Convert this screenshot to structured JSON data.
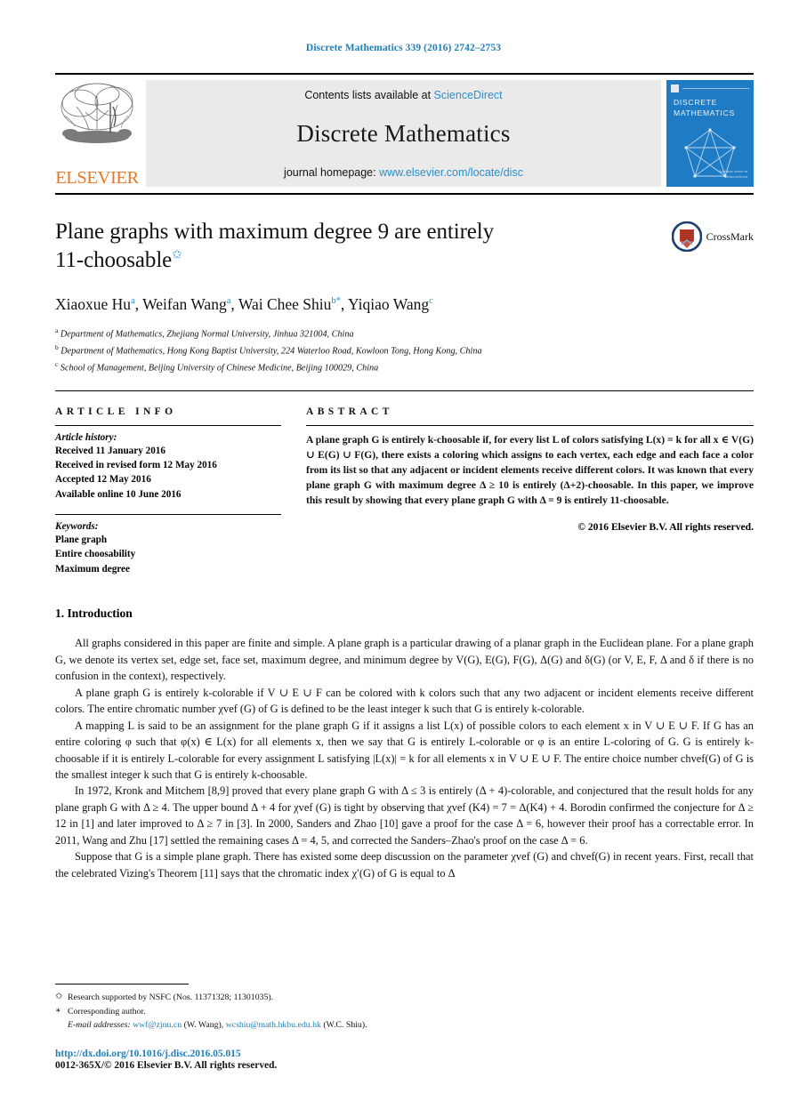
{
  "running_head": "Discrete Mathematics 339 (2016) 2742–2753",
  "banner": {
    "publisher_name": "ELSEVIER",
    "contents_prefix": "Contents lists available at ",
    "contents_link": "ScienceDirect",
    "journal_name": "Discrete Mathematics",
    "homepage_prefix": "journal homepage: ",
    "homepage_link": "www.elsevier.com/locate/disc",
    "cover_title_line1": "DISCRETE",
    "cover_title_line2": "MATHEMATICS",
    "cover_footer_line1": "Available online at",
    "cover_footer_line2": "ScienceDirect",
    "accent_blue": "#2c8fc9",
    "cover_blue": "#1f7cc4",
    "elsevier_orange": "#e87722"
  },
  "title": {
    "line1": "Plane graphs with maximum degree 9 are entirely",
    "line2": "11-choosable",
    "footnote_marker": "✩",
    "crossmark_label": "CrossMark"
  },
  "authors": {
    "list": [
      {
        "name": "Xiaoxue Hu",
        "marks": "a"
      },
      {
        "name": "Weifan Wang",
        "marks": "a"
      },
      {
        "name": "Wai Chee Shiu",
        "marks": "b",
        "corresponding": "*"
      },
      {
        "name": "Yiqiao Wang",
        "marks": "c"
      }
    ],
    "affiliations": [
      {
        "mark": "a",
        "text": "Department of Mathematics, Zhejiang Normal University, Jinhua 321004, China"
      },
      {
        "mark": "b",
        "text": "Department of Mathematics, Hong Kong Baptist University, 224 Waterloo Road, Kowloon Tong, Hong Kong, China"
      },
      {
        "mark": "c",
        "text": "School of Management, Beijing University of Chinese Medicine, Beijing 100029, China"
      }
    ]
  },
  "article_info": {
    "heading": "ARTICLE INFO",
    "history_title": "Article history:",
    "history": [
      "Received 11 January 2016",
      "Received in revised form 12 May 2016",
      "Accepted 12 May 2016",
      "Available online 10 June 2016"
    ],
    "keywords_title": "Keywords:",
    "keywords": [
      "Plane graph",
      "Entire choosability",
      "Maximum degree"
    ]
  },
  "abstract": {
    "heading": "ABSTRACT",
    "text": "A plane graph G is entirely k-choosable if, for every list L of colors satisfying L(x) = k for all x ∈ V(G) ∪ E(G) ∪ F(G), there exists a coloring which assigns to each vertex, each edge and each face a color from its list so that any adjacent or incident elements receive different colors. It was known that every plane graph G with maximum degree Δ ≥ 10 is entirely (Δ+2)-choosable. In this paper, we improve this result by showing that every plane graph G with Δ = 9 is entirely 11-choosable.",
    "copyright": "© 2016 Elsevier B.V. All rights reserved."
  },
  "body": {
    "section_number_title": "1. Introduction",
    "paragraphs": [
      "All graphs considered in this paper are finite and simple. A plane graph is a particular drawing of a planar graph in the Euclidean plane. For a plane graph G, we denote its vertex set, edge set, face set, maximum degree, and minimum degree by V(G), E(G), F(G), Δ(G) and δ(G) (or V, E, F, Δ and δ if there is no confusion in the context), respectively.",
      "A plane graph G is entirely k-colorable if V ∪ E ∪ F can be colored with k colors such that any two adjacent or incident elements receive different colors. The entire chromatic number χvef (G) of G is defined to be the least integer k such that G is entirely k-colorable.",
      "A mapping L is said to be an assignment for the plane graph G if it assigns a list L(x) of possible colors to each element x in V ∪ E ∪ F. If G has an entire coloring φ such that φ(x) ∈ L(x) for all elements x, then we say that G is entirely L-colorable or φ is an entire L-coloring of G. G is entirely k-choosable if it is entirely L-colorable for every assignment L satisfying |L(x)| = k for all elements x in V ∪ E ∪ F. The entire choice number chvef(G) of G is the smallest integer k such that G is entirely k-choosable.",
      "In 1972, Kronk and Mitchem [8,9] proved that every plane graph G with Δ ≤ 3 is entirely (Δ + 4)-colorable, and conjectured that the result holds for any plane graph G with Δ ≥ 4. The upper bound Δ + 4 for χvef (G) is tight by observing that χvef (K4) = 7 = Δ(K4) + 4. Borodin confirmed the conjecture for Δ ≥ 12 in [1] and later improved to Δ ≥ 7 in [3]. In 2000, Sanders and Zhao [10] gave a proof for the case Δ = 6, however their proof has a correctable error. In 2011, Wang and Zhu [17] settled the remaining cases Δ = 4, 5, and corrected the Sanders–Zhao's proof on the case Δ = 6.",
      "Suppose that G is a simple plane graph. There has existed some deep discussion on the parameter χvef (G) and chvef(G) in recent years. First, recall that the celebrated Vizing's Theorem [11] says that the chromatic index χ′(G) of G is equal to Δ"
    ],
    "citations": [
      "8,9",
      "1",
      "3",
      "10",
      "17",
      "11"
    ]
  },
  "footnotes": {
    "funding_marker": "✩",
    "funding": "Research supported by NSFC (Nos. 11371328; 11301035).",
    "corresponding_marker": "∗",
    "corresponding": "Corresponding author.",
    "email_label": "E-mail addresses:",
    "emails": [
      {
        "address": "wwf@zjnu.cn",
        "owner": "(W. Wang)"
      },
      {
        "address": "wcshiu@math.hkbu.edu.hk",
        "owner": "(W.C. Shiu)"
      }
    ]
  },
  "bottom": {
    "doi": "http://dx.doi.org/10.1016/j.disc.2016.05.015",
    "issn_line": "0012-365X/© 2016 Elsevier B.V. All rights reserved."
  }
}
